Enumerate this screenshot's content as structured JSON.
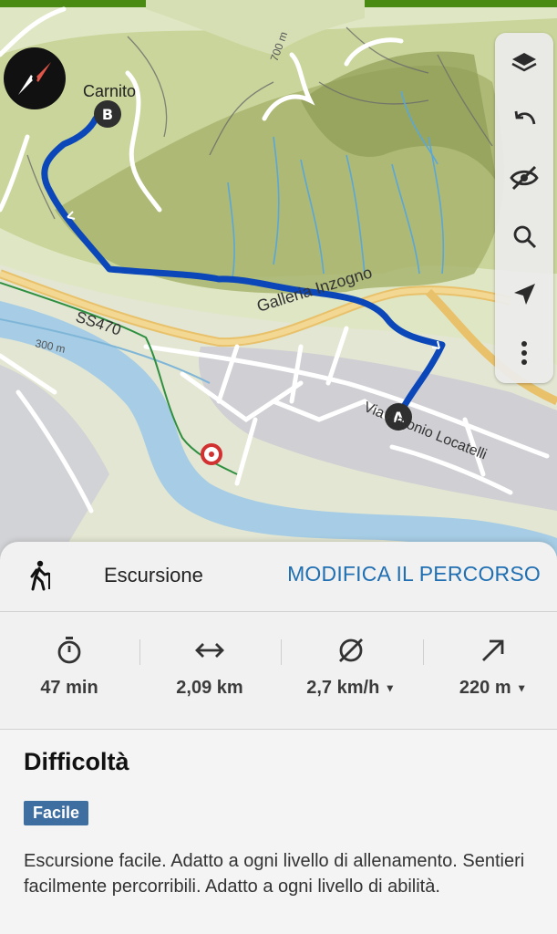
{
  "map": {
    "place_label": "Carnito",
    "road_label_1": "SS470",
    "road_label_2": "Galleria Inzogno",
    "street_label": "Via Antonio Locatelli",
    "contour_label_1": "300 m",
    "contour_label_2": "700 m",
    "marker_start": "A",
    "marker_end": "B",
    "route_color": "#0b47b8",
    "icons": {
      "compass": "compass-icon",
      "layers": "layers-icon",
      "undo": "undo-icon",
      "visibility": "eye-off-icon",
      "search": "search-icon",
      "locate": "navigation-arrow-icon",
      "more": "more-vert-icon"
    }
  },
  "activity": {
    "label": "Escursione",
    "edit_label": "MODIFICA IL PERCORSO",
    "icon": "hiker-icon",
    "accent": "#1f6fb2"
  },
  "stats": {
    "duration": {
      "value": "47  min",
      "icon": "stopwatch-icon"
    },
    "distance": {
      "value": "2,09 km",
      "icon": "distance-arrows-icon"
    },
    "speed": {
      "value": "2,7 km/h",
      "icon": "average-speed-icon"
    },
    "elevation": {
      "value": "220 m",
      "icon": "ascent-icon"
    }
  },
  "difficulty": {
    "title": "Difficoltà",
    "level": "Facile",
    "level_color": "#3f6fa0",
    "description": "Escursione facile. Adatto a ogni livello di allenamento. Sentieri facilmente percorribili. Adatto a ogni livello di abilità."
  }
}
